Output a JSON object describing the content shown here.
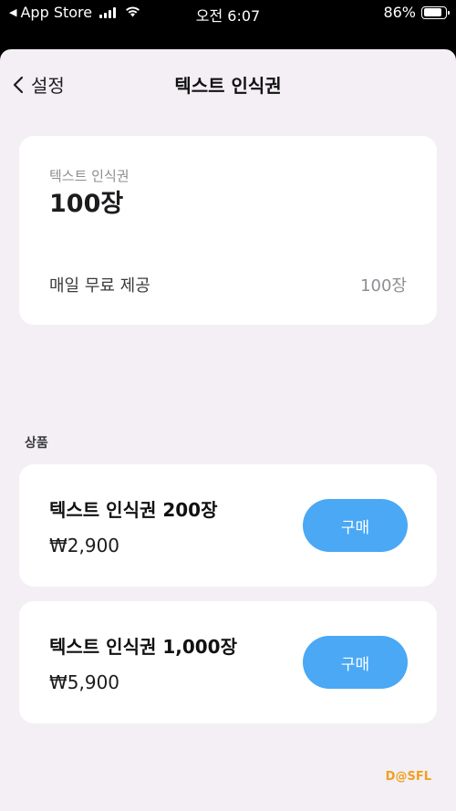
{
  "status_bar": {
    "back_app": "App Store",
    "time": "오전 6:07",
    "battery": "86%",
    "battery_level": 0.86
  },
  "nav": {
    "back_label": "설정",
    "title": "텍스트 인식권"
  },
  "summary": {
    "label": "텍스트 인식권",
    "value": "100장",
    "free_label": "매일 무료 제공",
    "free_value": "100장"
  },
  "products": {
    "section_label": "상품",
    "items": [
      {
        "name": "텍스트 인식권 200장",
        "price": "₩2,900",
        "button": "구매"
      },
      {
        "name": "텍스트 인식권 1,000장",
        "price": "₩5,900",
        "button": "구매"
      }
    ]
  },
  "watermark": "D@SFL",
  "colors": {
    "accent": "#4aa8f5",
    "background": "#f3eff4",
    "card": "#ffffff",
    "watermark": "#f0a020"
  }
}
